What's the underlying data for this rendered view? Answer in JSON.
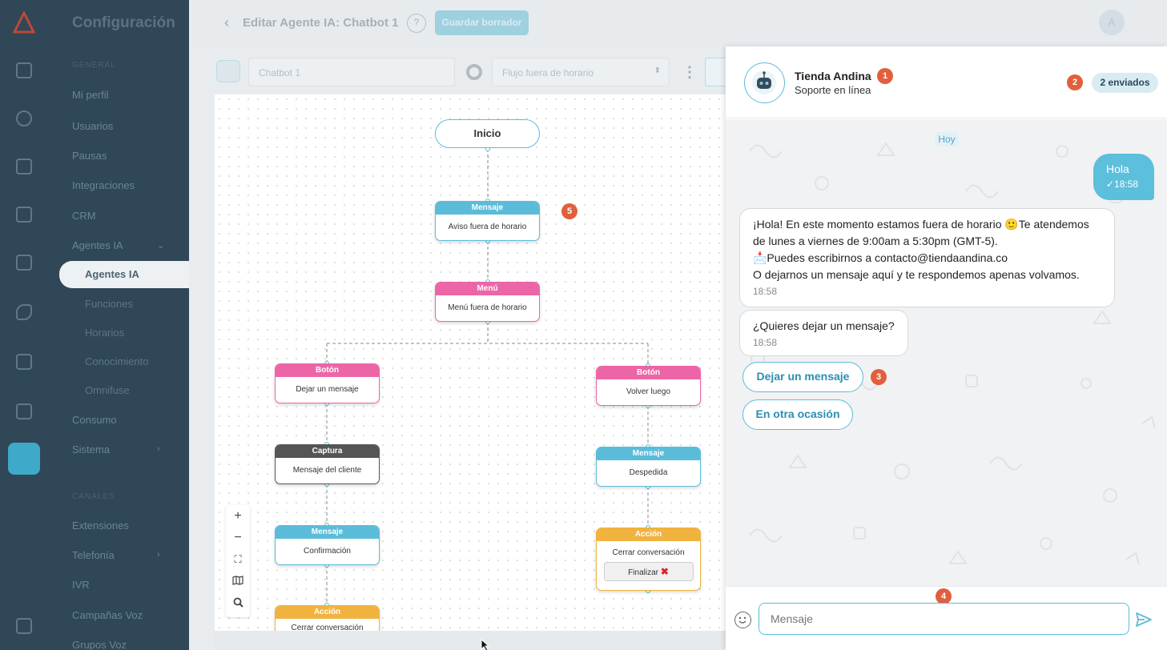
{
  "sidebar": {
    "title": "Configuración",
    "section_general": "GENERAL",
    "section_canales": "CANALES",
    "items": [
      {
        "label": "Mi perfil"
      },
      {
        "label": "Usuarios"
      },
      {
        "label": "Pausas"
      },
      {
        "label": "Integraciones"
      },
      {
        "label": "CRM"
      },
      {
        "label": "Agentes IA"
      },
      {
        "label": "Consumo"
      },
      {
        "label": "Sistema"
      },
      {
        "label": "Extensiones"
      },
      {
        "label": "Telefonía"
      },
      {
        "label": "IVR"
      },
      {
        "label": "Campañas Voz"
      },
      {
        "label": "Grupos Voz"
      }
    ],
    "subitems": [
      {
        "label": "Agentes IA"
      },
      {
        "label": "Funciones"
      },
      {
        "label": "Horarios"
      },
      {
        "label": "Conocimiento"
      },
      {
        "label": "Omnifuse"
      }
    ]
  },
  "header": {
    "title": "Editar Agente IA: Chatbot 1",
    "save_label": "Guardar borrador",
    "avatar_initial": "A"
  },
  "toolbar": {
    "bot_name": "Chatbot 1",
    "flow_name": "Flujo fuera de horario"
  },
  "flow": {
    "start_label": "Inicio",
    "nodes": [
      {
        "type": "Mensaje",
        "text": "Aviso fuera de horario"
      },
      {
        "type": "Menú",
        "text": "Menú fuera de horario"
      },
      {
        "type": "Botón",
        "text": "Dejar un mensaje"
      },
      {
        "type": "Botón",
        "text": "Volver luego"
      },
      {
        "type": "Captura",
        "text": "Mensaje del cliente"
      },
      {
        "type": "Mensaje",
        "text": "Despedida"
      },
      {
        "type": "Mensaje",
        "text": "Confirmación"
      },
      {
        "type": "Acción",
        "text": "Cerrar conversación",
        "button": "Finalizar"
      },
      {
        "type": "Acción",
        "text": "Cerrar conversación"
      }
    ],
    "colors": {
      "mensaje": "#5bbcd9",
      "menu": "#ec66a7",
      "captura": "#555555",
      "accion": "#f1b33f"
    }
  },
  "badges": {
    "b1": "1",
    "b2": "2",
    "b3": "3",
    "b4": "4",
    "b5": "5"
  },
  "chat": {
    "name": "Tienda Andina",
    "status": "Soporte en línea",
    "sent": "2 enviados",
    "day": "Hoy",
    "outgoing": {
      "text": "Hola",
      "time": "✓18:58"
    },
    "messages": [
      {
        "lines": [
          "¡Hola! En este momento estamos fuera de horario 🙂Te atendemos",
          "de lunes a viernes de 9:00am a 5:30pm (GMT-5).",
          "📩Puedes escribirnos a contacto@tiendaandina.co",
          "O dejarnos un mensaje aquí y te respondemos apenas volvamos."
        ],
        "time": "18:58"
      },
      {
        "lines": [
          "¿Quieres dejar un mensaje?"
        ],
        "time": "18:58"
      }
    ],
    "quick_replies": [
      "Dejar un mensaje",
      "En otra ocasión"
    ],
    "input_placeholder": "Mensaje"
  }
}
